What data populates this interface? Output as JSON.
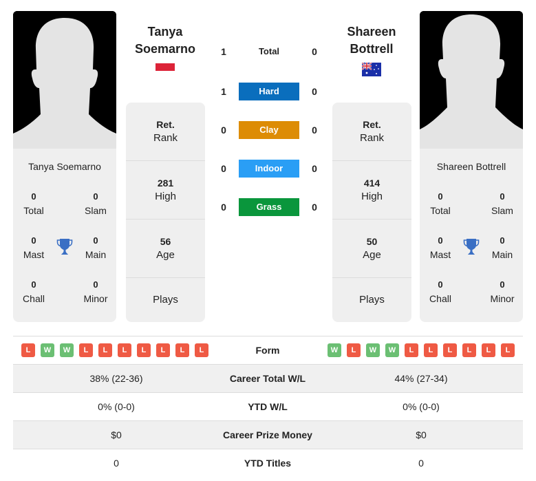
{
  "colors": {
    "hard": "#0a6ebd",
    "clay": "#dd8c05",
    "indoor": "#2a9ef5",
    "grass": "#0a963c",
    "win": "#6bbf73",
    "loss": "#ef5a44",
    "trophy": "#3a6fc4"
  },
  "players": [
    {
      "name_line1": "Tanya",
      "name_line2": "Soemarno",
      "full_name": "Tanya Soemarno",
      "flag": "indonesia-flag",
      "titles": {
        "total": "0",
        "total_label": "Total",
        "slam": "0",
        "slam_label": "Slam",
        "mast": "0",
        "mast_label": "Mast",
        "main": "0",
        "main_label": "Main",
        "chall": "0",
        "chall_label": "Chall",
        "minor": "0",
        "minor_label": "Minor"
      },
      "info": {
        "rank_value": "Ret.",
        "rank_label": "Rank",
        "high_value": "281",
        "high_label": "High",
        "age_value": "56",
        "age_label": "Age",
        "plays_value": "",
        "plays_label": "Plays"
      },
      "form": [
        "L",
        "W",
        "W",
        "L",
        "L",
        "L",
        "L",
        "L",
        "L",
        "L"
      ]
    },
    {
      "name_line1": "Shareen",
      "name_line2": "Bottrell",
      "full_name": "Shareen Bottrell",
      "flag": "australia-flag",
      "titles": {
        "total": "0",
        "total_label": "Total",
        "slam": "0",
        "slam_label": "Slam",
        "mast": "0",
        "mast_label": "Mast",
        "main": "0",
        "main_label": "Main",
        "chall": "0",
        "chall_label": "Chall",
        "minor": "0",
        "minor_label": "Minor"
      },
      "info": {
        "rank_value": "Ret.",
        "rank_label": "Rank",
        "high_value": "414",
        "high_label": "High",
        "age_value": "50",
        "age_label": "Age",
        "plays_value": "",
        "plays_label": "Plays"
      },
      "form": [
        "W",
        "L",
        "W",
        "W",
        "L",
        "L",
        "L",
        "L",
        "L",
        "L"
      ]
    }
  ],
  "h2h": [
    {
      "label": "Total",
      "left": "1",
      "right": "0"
    },
    {
      "label": "Hard",
      "left": "1",
      "right": "0"
    },
    {
      "label": "Clay",
      "left": "0",
      "right": "0"
    },
    {
      "label": "Indoor",
      "left": "0",
      "right": "0"
    },
    {
      "label": "Grass",
      "left": "0",
      "right": "0"
    }
  ],
  "table": {
    "form_label": "Form",
    "rows": [
      {
        "label": "Career Total W/L",
        "left": "38% (22-36)",
        "right": "44% (27-34)"
      },
      {
        "label": "YTD W/L",
        "left": "0% (0-0)",
        "right": "0% (0-0)"
      },
      {
        "label": "Career Prize Money",
        "left": "$0",
        "right": "$0"
      },
      {
        "label": "YTD Titles",
        "left": "0",
        "right": "0"
      }
    ]
  }
}
